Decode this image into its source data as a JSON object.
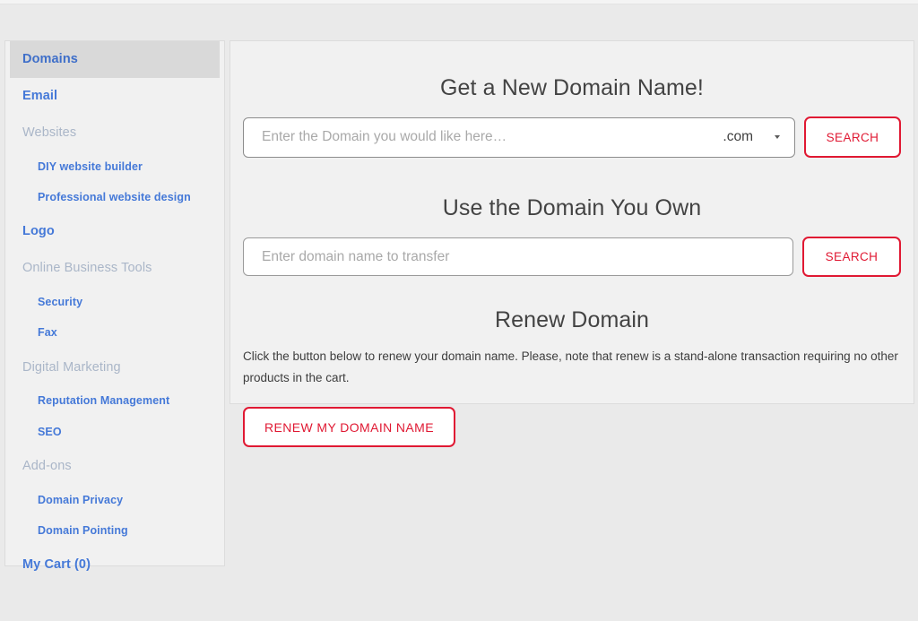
{
  "sidebar": {
    "items": [
      {
        "label": "Domains",
        "type": "top",
        "active": true,
        "name": "sidebar-item-domains"
      },
      {
        "label": "Email",
        "type": "top",
        "active": false,
        "name": "sidebar-item-email"
      },
      {
        "label": "Websites",
        "type": "section",
        "active": false,
        "name": "sidebar-section-websites"
      },
      {
        "label": "DIY website builder",
        "type": "sub",
        "active": false,
        "name": "sidebar-item-diy-website-builder"
      },
      {
        "label": "Professional website design",
        "type": "sub",
        "active": false,
        "name": "sidebar-item-professional-website-design"
      },
      {
        "label": "Logo",
        "type": "top",
        "active": false,
        "name": "sidebar-item-logo"
      },
      {
        "label": "Online Business Tools",
        "type": "section",
        "active": false,
        "name": "sidebar-section-online-business-tools"
      },
      {
        "label": "Security",
        "type": "sub",
        "active": false,
        "name": "sidebar-item-security"
      },
      {
        "label": "Fax",
        "type": "sub",
        "active": false,
        "name": "sidebar-item-fax"
      },
      {
        "label": "Digital Marketing",
        "type": "section",
        "active": false,
        "name": "sidebar-section-digital-marketing"
      },
      {
        "label": "Reputation Management",
        "type": "sub",
        "active": false,
        "name": "sidebar-item-reputation-management"
      },
      {
        "label": "SEO",
        "type": "sub",
        "active": false,
        "name": "sidebar-item-seo"
      },
      {
        "label": "Add-ons",
        "type": "section",
        "active": false,
        "name": "sidebar-section-add-ons"
      },
      {
        "label": "Domain Privacy",
        "type": "sub",
        "active": false,
        "name": "sidebar-item-domain-privacy"
      },
      {
        "label": "Domain Pointing",
        "type": "sub",
        "active": false,
        "name": "sidebar-item-domain-pointing"
      },
      {
        "label": "My Cart (0)",
        "type": "top",
        "active": false,
        "name": "sidebar-item-my-cart"
      }
    ]
  },
  "main": {
    "new_domain": {
      "title": "Get a New Domain Name!",
      "input_value": "",
      "input_placeholder": "Enter the Domain you would like here…",
      "tld_selected": ".com",
      "tld_caret_icon": "caret-down-icon",
      "search_label": "SEARCH"
    },
    "transfer_domain": {
      "title": "Use the Domain You Own",
      "input_value": "",
      "input_placeholder": "Enter domain name to transfer",
      "search_label": "SEARCH"
    },
    "renew_domain": {
      "title": "Renew Domain",
      "description": "Click the button below to renew your domain name. Please, note that renew is a stand-alone transaction requiring no other products in the cart.",
      "button_label": "RENEW MY DOMAIN NAME"
    }
  },
  "colors": {
    "accent_red": "#e01933",
    "link_blue": "#4579d8",
    "section_grey": "#aab6c8",
    "active_bg": "#d9d9d9",
    "panel_bg": "#f1f1f1",
    "page_bg": "#eaeaea"
  }
}
